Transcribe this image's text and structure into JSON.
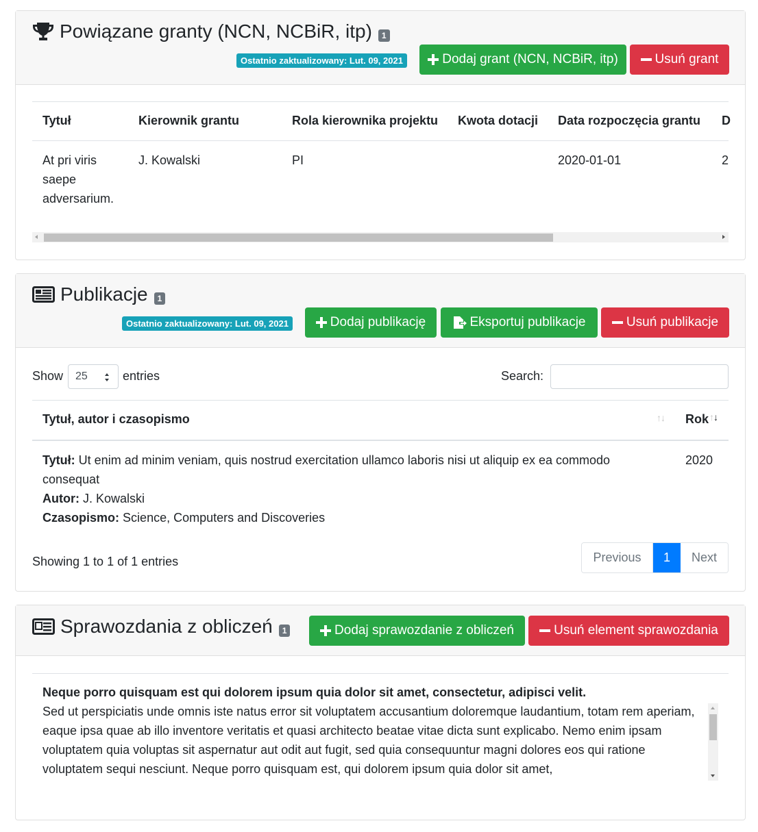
{
  "grants": {
    "title": "Powiązane granty (NCN, NCBiR, itp)",
    "count": "1",
    "updated": "Ostatnio zaktualizowany: Lut. 09, 2021",
    "add_label": "Dodaj grant (NCN, NCBiR, itp)",
    "remove_label": "Usuń grant",
    "columns": [
      "Tytuł",
      "Kierownik grantu",
      "Rola kierownika projektu",
      "Kwota dotacji",
      "Data rozpoczęcia grantu",
      "D"
    ],
    "rows": [
      {
        "title": "At pri viris saepe adversarium.",
        "lead": "J. Kowalski",
        "role": "PI",
        "amount": "",
        "start": "2020-01-01",
        "cut": "2"
      }
    ]
  },
  "publications": {
    "title": "Publikacje",
    "count": "1",
    "updated": "Ostatnio zaktualizowany: Lut. 09, 2021",
    "add_label": "Dodaj publikację",
    "export_label": "Eksportuj publikacje",
    "remove_label": "Usuń publikacje",
    "show_label": "Show",
    "entries_value": "25",
    "entries_label": "entries",
    "search_label": "Search:",
    "search_value": "",
    "columns": [
      "Tytuł, autor i czasopismo",
      "Rok"
    ],
    "rows": [
      {
        "title_label": "Tytuł:",
        "title": "Ut enim ad minim veniam, quis nostrud exercitation ullamco laboris nisi ut aliquip ex ea commodo consequat",
        "author_label": "Autor:",
        "author": "J. Kowalski",
        "journal_label": "Czasopismo:",
        "journal": "Science, Computers and Discoveries",
        "year": "2020"
      }
    ],
    "info": "Showing 1 to 1 of 1 entries",
    "pagination": {
      "previous": "Previous",
      "page": "1",
      "next": "Next"
    }
  },
  "reports": {
    "title": "Sprawozdania z obliczeń",
    "count": "1",
    "add_label": "Dodaj sprawozdanie z obliczeń",
    "remove_label": "Usuń element sprawozdania",
    "heading": "Neque porro quisquam est qui dolorem ipsum quia dolor sit amet, consectetur, adipisci velit.",
    "body": "Sed ut perspiciatis unde omnis iste natus error sit voluptatem accusantium doloremque laudantium, totam rem aperiam, eaque ipsa quae ab illo inventore veritatis et quasi architecto beatae vitae dicta sunt explicabo. Nemo enim ipsam voluptatem quia voluptas sit aspernatur aut odit aut fugit, sed quia consequuntur magni dolores eos qui ratione voluptatem sequi nesciunt. Neque porro quisquam est, qui dolorem ipsum quia dolor sit amet,"
  },
  "colors": {
    "green": "#28a745",
    "red": "#dc3545",
    "info": "#17a2b8",
    "primary": "#007bff",
    "secondary": "#6c757d"
  }
}
